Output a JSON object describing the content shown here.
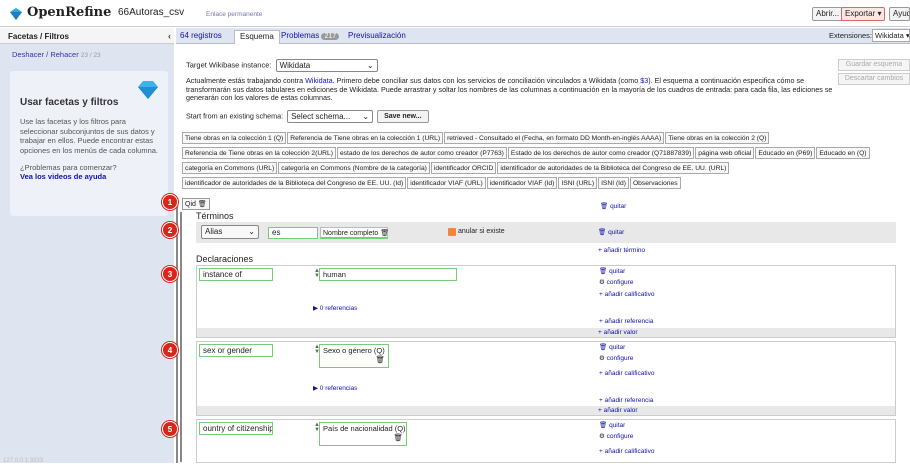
{
  "header": {
    "brand": "OpenRefine",
    "project": "66Autoras_csv",
    "permalink": "Enlace permanente",
    "open_btn": "Abrir...",
    "export_btn": "Exportar ▾",
    "help_btn": "Ayuda"
  },
  "sidebar": {
    "tab": "Facetas / Filtros",
    "undo_label": "Deshacer / Rehacer",
    "undo_count": "23 / 23",
    "help_title": "Usar facetas y filtros",
    "help_text": "Use las facetas y los filtros para seleccionar subconjuntos de sus datos y trabajar en ellos. Puede encontrar estas opciones en los menús de cada columna.",
    "help_question": "¿Problemas para comenzar?",
    "help_link": "Vea los videos de ayuda",
    "footer_ip": "127.0.0.1:3333"
  },
  "view_tabs": {
    "records": "64 registros",
    "schema": "Esquema",
    "problems": "Problemas",
    "problems_count": "217",
    "preview": "Previsualización",
    "extensions_label": "Extensiones:",
    "extensions_select": "Wikidata ▾"
  },
  "schema": {
    "instance_label": "Target Wikibase instance:",
    "instance_value": "Wikidata",
    "save_schema": "Guardar esquema",
    "discard": "Descartar cambios",
    "desc_1": "Actualmente estás trabajando contra ",
    "desc_link": "Wikidata",
    "desc_2": ". Primero debe conciliar sus datos con los servicios de conciliación vinculados a Wikidata (como ",
    "desc_link2": "$3",
    "desc_3": "). El esquema a continuación especifica cómo se transformarán sus datos tabulares en ediciones de Wikidata. Puede arrastrar y soltar los nombres de las columnas a continuación en la mayoría de los cuadros de entrada: para cada fila, las ediciones se generarán con los valores de estas columnas.",
    "start_label": "Start from an existing schema:",
    "select_schema": "Select schema...",
    "save_new": "Save new..."
  },
  "columns": [
    "Tiene obras en la colección 1 (Q)",
    "Referencia de Tiene obras en la colección 1 (URL)",
    "retrieved - Consultado el (Fecha, en formato DD Month-en-inglés AAAA)",
    "Tiene obras en la colección 2 (Q)",
    "Referencia de Tiene obras en la colección 2(URL)",
    "estado de los derechos de autor como creador (P7763)",
    "Estado de los derechos de autor como creador (Q71887839)",
    "página web oficial",
    "Educado en (P69)",
    "Educado en (Q)",
    "categoría en Commons (URL)",
    "categoría en Commons (Nombre de la categoría)",
    "identificador ORCID",
    "identificador de autoridades de la Biblioteca del Congreso de EE. UU. (URL)",
    "identificador de autoridades de la Biblioteca del Congreso de EE. UU. (Id)",
    "identificador VIAF (URL)",
    "identificador VIAF (Id)",
    "ISNI (URL)",
    "ISNI (Id)",
    "Observaciones"
  ],
  "item": {
    "qid": "Qid",
    "remove": "quitar",
    "terms_heading": "Términos",
    "term_type": "Alias",
    "term_lang": "es",
    "term_value": "Nombre completo",
    "override_label": "anular si existe",
    "add_term": "+ añadir término",
    "statements_heading": "Declaraciones"
  },
  "statements": [
    {
      "property": "instance of",
      "value": "human",
      "refs": "▶ 0 referencias",
      "badge": "3"
    },
    {
      "property": "sex or gender",
      "value": "Sexo o género (Q)",
      "refs": "▶ 0 referencias",
      "badge": "4"
    },
    {
      "property": "ountry of citizenship",
      "value": "País de nacionalidad (Q)",
      "badge": "5"
    }
  ],
  "actions": {
    "remove": "quitar",
    "configure": "configure",
    "add_qualifier": "+ añadir calificativo",
    "add_reference": "+ añadir referencia",
    "add_value": "+ añadir valor"
  },
  "badges": {
    "b1": "1",
    "b2": "2"
  },
  "colors": {
    "accent": "#11a",
    "badge": "#d9261c",
    "sidebar_bg": "#dfe5f0",
    "checkbox": "#f5843f"
  }
}
